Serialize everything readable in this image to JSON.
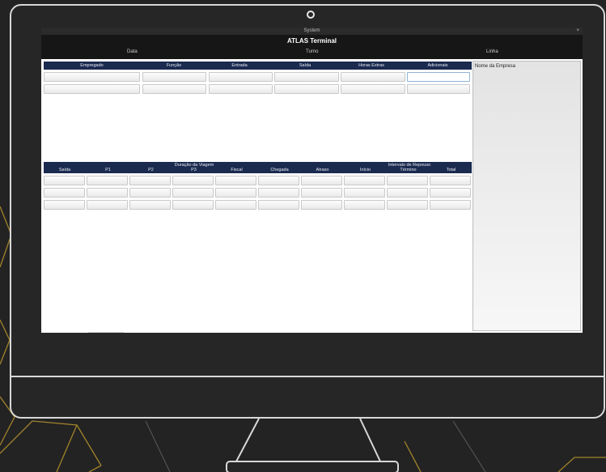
{
  "window": {
    "title": "System",
    "close_glyph": "×"
  },
  "app": {
    "title": "ATLAS Terminal"
  },
  "header_fields": {
    "date_label": "Data",
    "shift_label": "Turno",
    "line_label": "Linha"
  },
  "table1": {
    "columns": [
      "Empregado",
      "Função",
      "Entrada",
      "Saída",
      "Horas Extras",
      "Adicionais"
    ],
    "rows": [
      [
        "",
        "",
        "",
        "",
        "",
        ""
      ],
      [
        "",
        "",
        "",
        "",
        "",
        ""
      ]
    ]
  },
  "table2": {
    "group_duration": "Duração da Viagem",
    "group_rest": "Intervalo de Repouso",
    "columns": [
      "Saída",
      "P1",
      "P2",
      "P3",
      "Fiscal",
      "Chegada",
      "Atraso",
      "Início",
      "Término",
      "Total"
    ],
    "rows": [
      [
        "",
        "",
        "",
        "",
        "",
        "",
        "",
        "",
        "",
        ""
      ],
      [
        "",
        "",
        "",
        "",
        "",
        "",
        "",
        "",
        "",
        ""
      ],
      [
        "",
        "",
        "",
        "",
        "",
        "",
        "",
        "",
        "",
        ""
      ]
    ]
  },
  "side_panel": {
    "label": "Nome da Empresa"
  },
  "colors": {
    "header_navy": "#1b2a4f",
    "app_header": "#161616",
    "accent_gold": "#c9a227"
  }
}
